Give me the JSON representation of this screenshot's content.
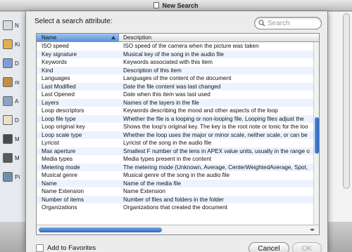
{
  "window": {
    "title": "New Search"
  },
  "bg_sidebar": {
    "items": [
      {
        "label": "N",
        "color": "#d9d9d9"
      },
      {
        "label": "Ki",
        "color": "#e0b050"
      },
      {
        "label": "D",
        "color": "#7a9fd6"
      },
      {
        "label": "m",
        "color": "#c58d45"
      },
      {
        "label": "A",
        "color": "#8aa4c8"
      },
      {
        "label": "D",
        "color": "#e8e0c8"
      },
      {
        "label": "M",
        "color": "#4a4a4a"
      },
      {
        "label": "M",
        "color": "#5a5a5a"
      },
      {
        "label": "Pi",
        "color": "#6f8fb0"
      }
    ]
  },
  "dialog": {
    "prompt": "Select a search attribute:",
    "search": {
      "placeholder": "Search",
      "icon": "magnifier-icon"
    },
    "table": {
      "columns": {
        "name": "Name",
        "description": "Description"
      },
      "rows": [
        {
          "name": "ISO speed",
          "description": "ISO speed of the camera when the picture was taken"
        },
        {
          "name": "Key signature",
          "description": "Musical key of the song in the audio file"
        },
        {
          "name": "Keywords",
          "description": "Keywords associated with this item"
        },
        {
          "name": "Kind",
          "description": "Description of this item"
        },
        {
          "name": "Languages",
          "description": "Languages of the content of the document"
        },
        {
          "name": "Last Modified",
          "description": "Date the file content was last changed"
        },
        {
          "name": "Last Opened",
          "description": "Date when this item was last used"
        },
        {
          "name": "Layers",
          "description": "Names of the layers in the file"
        },
        {
          "name": "Loop descriptors",
          "description": "Keywords describing the mood and other aspects of the loop"
        },
        {
          "name": "Loop file type",
          "description": "Whether the file is a looping or non-looping file. Looping files adjust the"
        },
        {
          "name": "Loop original key",
          "description": "Shows the loop's original key. The key is the root note or tonic for the loo"
        },
        {
          "name": "Loop scale type",
          "description": "Whether the loop uses the major or minor scale, neither scale, or can be"
        },
        {
          "name": "Lyricist",
          "description": "Lyricist of the song in the audio file"
        },
        {
          "name": "Max aperture",
          "description": "Smallest F number of the lens in APEX value units, usually in the range o"
        },
        {
          "name": "Media types",
          "description": "Media types present in the content"
        },
        {
          "name": "Metering mode",
          "description": "The metering mode (Unknown, Average, CenterWeightedAverage, Spot,"
        },
        {
          "name": "Musical genre",
          "description": "Musical genre of the song in the audio file"
        },
        {
          "name": "Name",
          "description": "Name of the media file"
        },
        {
          "name": "Name Extension",
          "description": "Name Extension"
        },
        {
          "name": "Number of items",
          "description": "Number of files and folders in the folder"
        },
        {
          "name": "Organizations",
          "description": "Organizations that created the document"
        }
      ]
    },
    "favorites_label": "Add to Favorites",
    "cancel_label": "Cancel",
    "ok_label": "OK",
    "scroll_arrows": "◂▸"
  }
}
